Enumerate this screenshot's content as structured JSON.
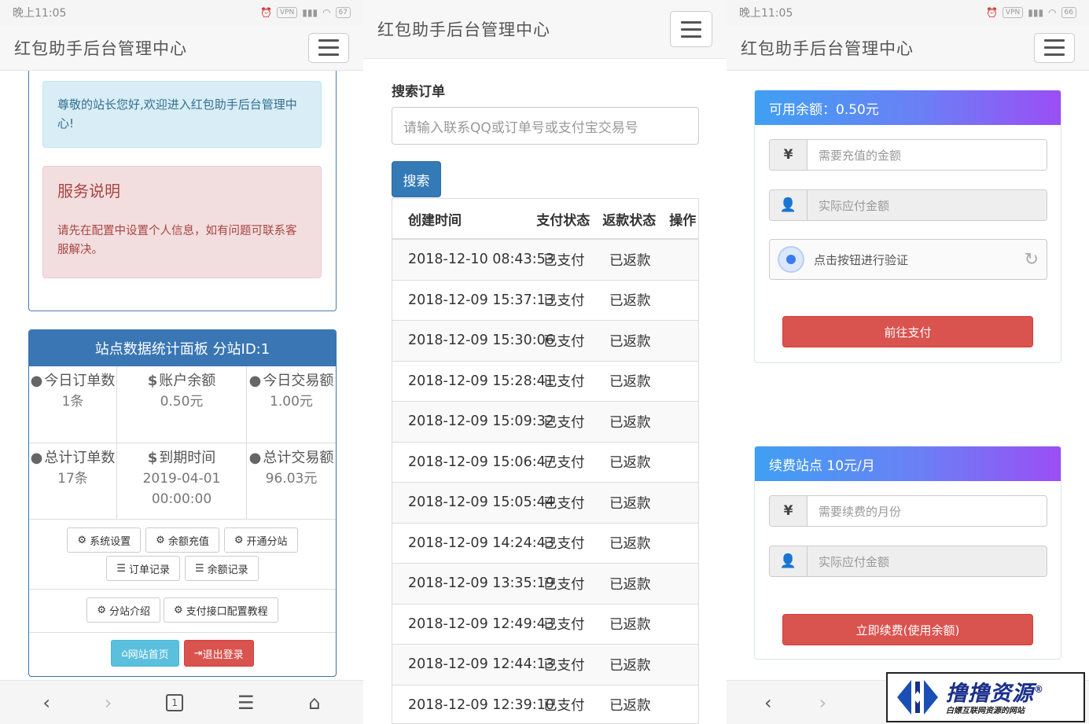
{
  "status": {
    "time": "晚上11:05",
    "battery1": "67",
    "battery3": "66",
    "vpn": "VPN"
  },
  "navbar": {
    "brand": "红包助手后台管理中心"
  },
  "home": {
    "welcome": "尊敬的站长您好,欢迎进入红包助手后台管理中心!",
    "notice_title": "服务说明",
    "notice_body": "请先在配置中设置个人信息，如有问题可联系客服解决。",
    "stats_title": "站点数据统计面板 分站ID:1",
    "stats": [
      {
        "label": "今日订单数",
        "value": "1条",
        "icon": "drop-icon"
      },
      {
        "label": "账户余额",
        "value": "0.50元",
        "icon": "dollar-icon"
      },
      {
        "label": "今日交易额",
        "value": "1.00元",
        "icon": "drop-icon"
      },
      {
        "label": "总计订单数",
        "value": "17条",
        "icon": "drop-icon"
      },
      {
        "label": "到期时间",
        "value": "2019-04-01 00:00:00",
        "icon": "dollar-icon"
      },
      {
        "label": "总计交易额",
        "value": "96.03元",
        "icon": "drop-icon"
      }
    ],
    "buttons": {
      "settings": "系统设置",
      "recharge": "余额充值",
      "open_substation": "开通分站",
      "order_records": "订单记录",
      "balance_records": "余额记录",
      "substation_intro": "分站介绍",
      "payment_tutorial": "支付接口配置教程",
      "home": "网站首页",
      "logout": "退出登录"
    }
  },
  "bottom_nav": {
    "tab_count": "1"
  },
  "orders": {
    "search_label": "搜索订单",
    "search_placeholder": "请输入联系QQ或订单号或支付宝交易号",
    "search_button": "搜索",
    "columns": [
      "创建时间",
      "支付状态",
      "返款状态",
      "操作"
    ],
    "rows": [
      [
        "2018-12-10 08:43:53",
        "已支付",
        "已返款"
      ],
      [
        "2018-12-09 15:37:13",
        "已支付",
        "已返款"
      ],
      [
        "2018-12-09 15:30:06",
        "已支付",
        "已返款"
      ],
      [
        "2018-12-09 15:28:41",
        "已支付",
        "已返款"
      ],
      [
        "2018-12-09 15:09:32",
        "已支付",
        "已返款"
      ],
      [
        "2018-12-09 15:06:47",
        "已支付",
        "已返款"
      ],
      [
        "2018-12-09 15:05:44",
        "已支付",
        "已返款"
      ],
      [
        "2018-12-09 14:24:43",
        "已支付",
        "已返款"
      ],
      [
        "2018-12-09 13:35:19",
        "已支付",
        "已返款"
      ],
      [
        "2018-12-09 12:49:43",
        "已支付",
        "已返款"
      ],
      [
        "2018-12-09 12:44:13",
        "已支付",
        "已返款"
      ],
      [
        "2018-12-09 12:39:10",
        "已支付",
        "已返款"
      ]
    ]
  },
  "recharge": {
    "title": "可用余额：0.50元",
    "amount_placeholder": "需要充值的金额",
    "pay_placeholder": "实际应付金额",
    "captcha_text": "点击按钮进行验证",
    "submit": "前往支付",
    "currency_symbol": "¥"
  },
  "renew": {
    "title": "续费站点 10元/月",
    "months_placeholder": "需要续费的月份",
    "pay_placeholder": "实际应付金额",
    "submit": "立即续费(使用余额)"
  },
  "watermark": {
    "title": "撸撸资源",
    "subtitle": "白嫖互联网资源的网站",
    "reg": "®"
  },
  "colors": {
    "primary": "#337ab7",
    "danger": "#d9534f",
    "info": "#5bc0de",
    "gradient_start": "#3fa0f3",
    "gradient_end": "#9b4ef5"
  }
}
